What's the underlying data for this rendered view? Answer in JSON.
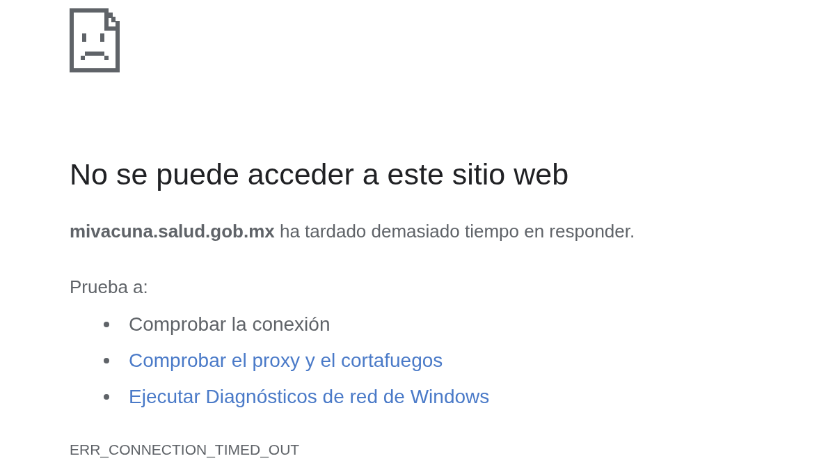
{
  "heading": "No se puede acceder a este sitio web",
  "message": "**mivacuna.salud.gob.mx** ha tardado demasiado tiempo en responder.",
  "suggestions_label": "Prueba a:",
  "suggestions": [
    {
      "kind": "text",
      "label": "Comprobar la conexión"
    },
    {
      "kind": "link",
      "label": "Comprobar el proxy y el cortafuegos"
    },
    {
      "kind": "link",
      "label": "Ejecutar Diagnósticos de red de Windows"
    }
  ],
  "error_code": "ERR_CONNECTION_TIMED_OUT"
}
